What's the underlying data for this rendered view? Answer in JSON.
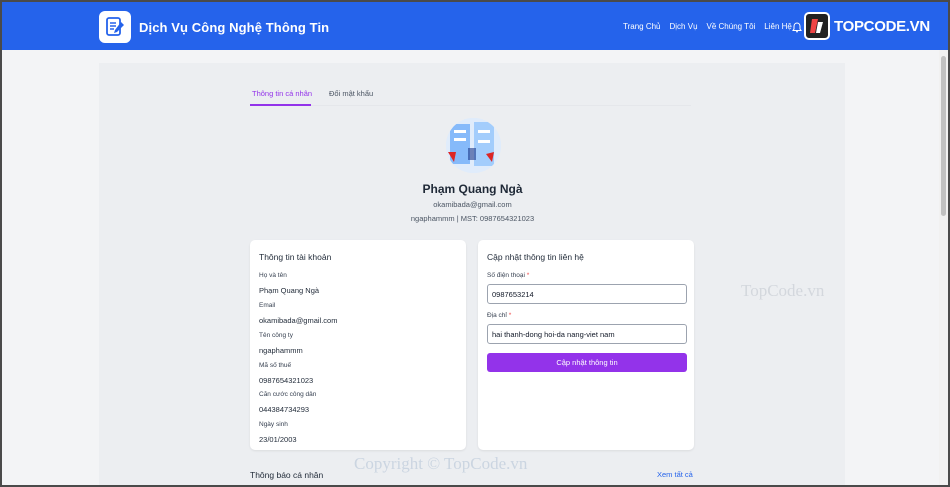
{
  "header": {
    "title": "Dịch Vụ Công Nghệ Thông Tin",
    "nav": [
      "Trang Chủ",
      "Dịch Vụ",
      "Về Chúng Tôi",
      "Liên Hệ"
    ],
    "watermark_logo": "TOPCODE.VN"
  },
  "tabs": {
    "active": "Thông tin cá nhân",
    "other": "Đổi mật khẩu"
  },
  "profile": {
    "name": "Phạm Quang Ngà",
    "email": "okamibada@gmail.com",
    "meta": "ngaphammm | MST: 0987654321023"
  },
  "account": {
    "title": "Thông tin tài khoản",
    "fields": [
      {
        "label": "Họ và tên",
        "value": "Phạm Quang Ngà"
      },
      {
        "label": "Email",
        "value": "okamibada@gmail.com"
      },
      {
        "label": "Tên công ty",
        "value": "ngaphammm"
      },
      {
        "label": "Mã số thuế",
        "value": "0987654321023"
      },
      {
        "label": "Căn cước công dân",
        "value": "044384734293"
      },
      {
        "label": "Ngày sinh",
        "value": "23/01/2003"
      }
    ]
  },
  "contact": {
    "title": "Cập nhật thông tin liên hệ",
    "phone_label": "Số điện thoại",
    "phone_value": "0987653214",
    "address_label": "Địa chỉ",
    "address_value": "hai thanh-dong hoi-da nang-viet nam",
    "required_mark": "*",
    "button": "Cập nhật thông tin"
  },
  "notifications": {
    "title": "Thông báo cá nhân",
    "view_all": "Xem tất cả"
  },
  "watermarks": {
    "middle": "TopCode.vn",
    "bottom": "Copyright © TopCode.vn"
  },
  "colors": {
    "navbar": "#2563eb",
    "accent": "#9333ea",
    "link": "#2563eb"
  }
}
